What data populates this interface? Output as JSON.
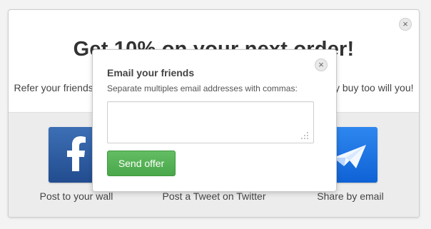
{
  "main_modal": {
    "headline": "Get 10% on your next order!",
    "subline": "Refer your friends and we will give you 10% off your next order when they buy too will you!"
  },
  "share_options": {
    "facebook": {
      "icon": "facebook-icon",
      "label": "Post to your wall",
      "color": "#3d6fb5"
    },
    "twitter": {
      "label": "Post a Tweet on Twitter"
    },
    "email": {
      "icon": "paper-plane-icon",
      "label": "Share by email",
      "color": "#1f75e6"
    }
  },
  "email_dialog": {
    "title": "Email your friends",
    "subtitle": "Separate multiples email addresses with commas:",
    "textarea_value": "",
    "button_label": "Send offer",
    "button_color": "#56b356"
  },
  "icons": {
    "close": "×"
  }
}
